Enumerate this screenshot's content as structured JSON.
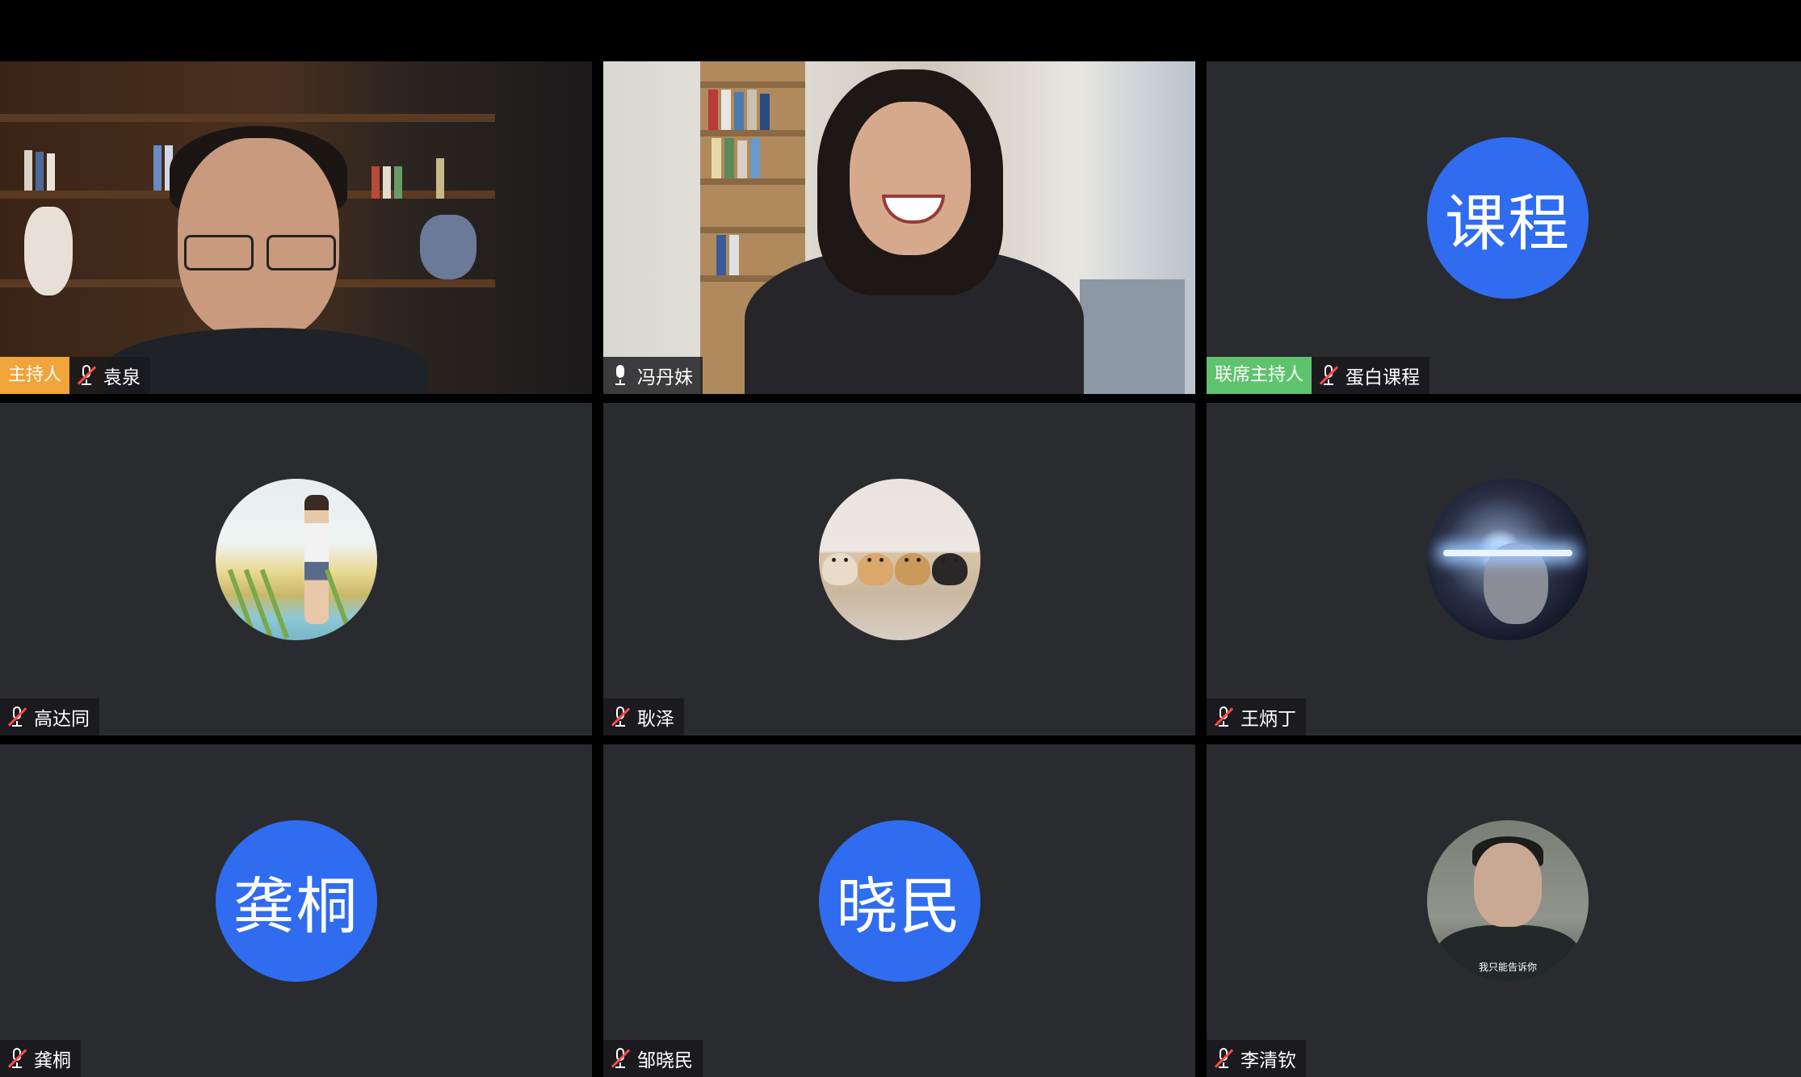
{
  "participants": [
    {
      "name": "袁泉",
      "role_badge": "主持人",
      "mic": "muted",
      "tile": "video"
    },
    {
      "name": "冯丹妹",
      "role_badge": "",
      "mic": "on",
      "tile": "video"
    },
    {
      "name": "蛋白课程",
      "role_badge": "联席主持人",
      "mic": "muted",
      "tile": "avatar-text",
      "avatar_text": "课程"
    },
    {
      "name": "高达同",
      "role_badge": "",
      "mic": "muted",
      "tile": "avatar-image",
      "avatar_image": "boy-in-reeds-illustration"
    },
    {
      "name": "耿泽",
      "role_badge": "",
      "mic": "muted",
      "tile": "avatar-image",
      "avatar_image": "four-dogs-in-bed"
    },
    {
      "name": "王炳丁",
      "role_badge": "",
      "mic": "muted",
      "tile": "avatar-image",
      "avatar_image": "glowing-eyes-portrait"
    },
    {
      "name": "龚桐",
      "role_badge": "",
      "mic": "muted",
      "tile": "avatar-text",
      "avatar_text": "龚桐"
    },
    {
      "name": "邹晓民",
      "role_badge": "",
      "mic": "muted",
      "tile": "avatar-text",
      "avatar_text": "晓民"
    },
    {
      "name": "李清钦",
      "role_badge": "",
      "mic": "muted",
      "tile": "avatar-image",
      "avatar_image": "officer-portrait",
      "avatar_caption": "我只能告诉你"
    }
  ],
  "colors": {
    "tile_bg": "#2a2b2f",
    "avatar_blue": "#2f6cf0",
    "host_badge": "#f0a43a",
    "cohost_badge": "#5ec36c",
    "muted_red": "#ff4a4a"
  }
}
